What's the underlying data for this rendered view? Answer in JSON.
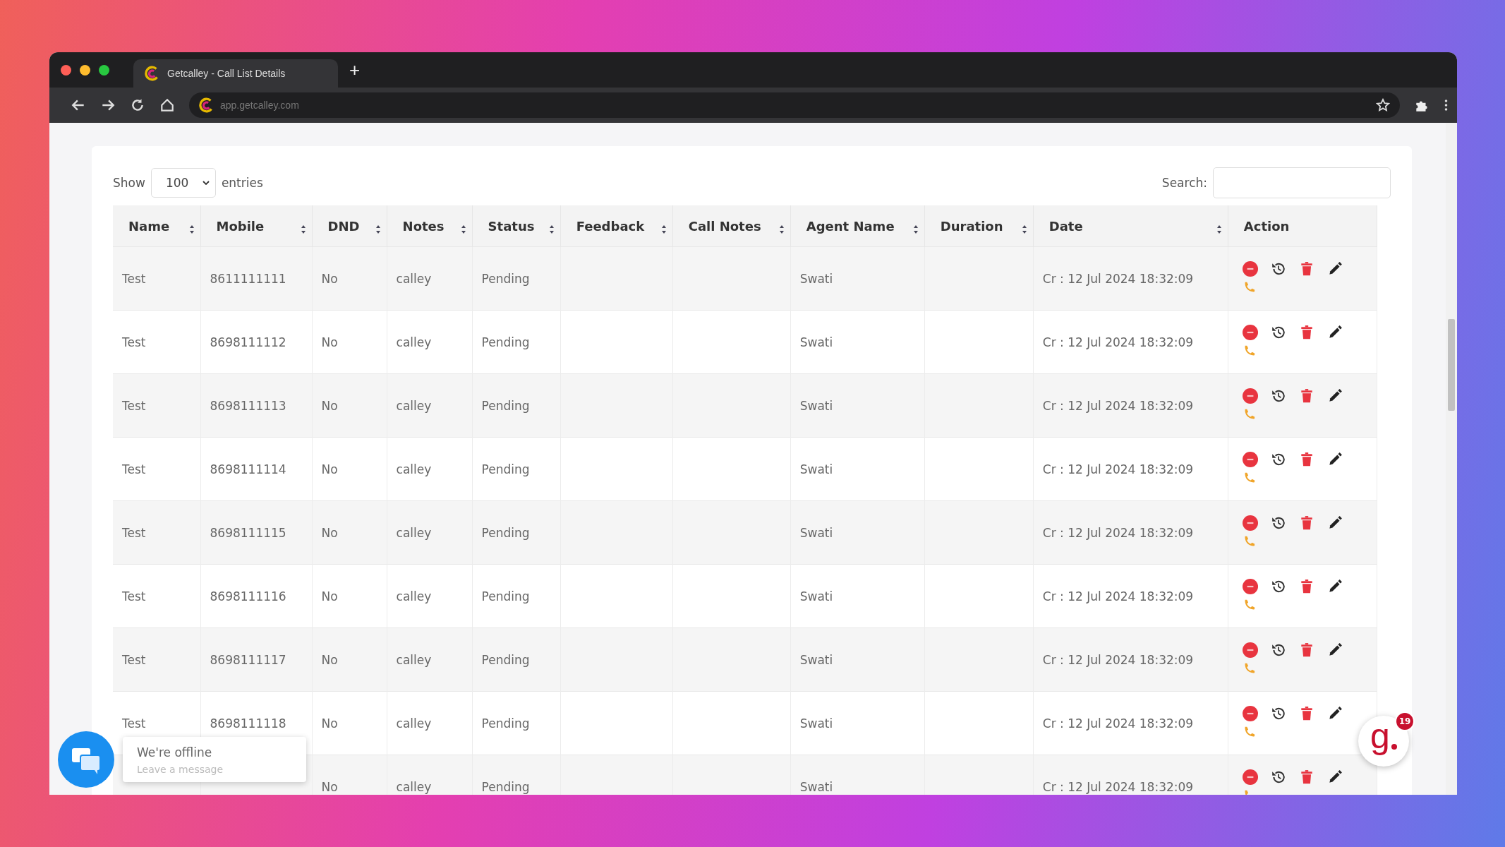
{
  "browser": {
    "tab_title": "Getcalley - Call List Details",
    "new_tab": "+",
    "url": "app.getcalley.com"
  },
  "controls": {
    "show_label": "Show",
    "page_length": "100",
    "entries_label": "entries",
    "search_label": "Search:"
  },
  "table": {
    "columns": [
      {
        "label": "Name",
        "sortable": true
      },
      {
        "label": "Mobile",
        "sortable": true
      },
      {
        "label": "DND",
        "sortable": true
      },
      {
        "label": "Notes",
        "sortable": true
      },
      {
        "label": "Status",
        "sortable": true
      },
      {
        "label": "Feedback",
        "sortable": true
      },
      {
        "label": "Call Notes",
        "sortable": true
      },
      {
        "label": "Agent Name",
        "sortable": true
      },
      {
        "label": "Duration",
        "sortable": true
      },
      {
        "label": "Date",
        "sortable": true
      },
      {
        "label": "Action",
        "sortable": false
      }
    ],
    "rows": [
      {
        "name": "Test",
        "mobile": "8611111111",
        "dnd": "No",
        "notes": "calley",
        "status": "Pending",
        "agent_name": "Swati",
        "date": "Cr : 12 Jul 2024 18:32:09"
      },
      {
        "name": "Test",
        "mobile": "8698111112",
        "dnd": "No",
        "notes": "calley",
        "status": "Pending",
        "agent_name": "Swati",
        "date": "Cr : 12 Jul 2024 18:32:09"
      },
      {
        "name": "Test",
        "mobile": "8698111113",
        "dnd": "No",
        "notes": "calley",
        "status": "Pending",
        "agent_name": "Swati",
        "date": "Cr : 12 Jul 2024 18:32:09"
      },
      {
        "name": "Test",
        "mobile": "8698111114",
        "dnd": "No",
        "notes": "calley",
        "status": "Pending",
        "agent_name": "Swati",
        "date": "Cr : 12 Jul 2024 18:32:09"
      },
      {
        "name": "Test",
        "mobile": "8698111115",
        "dnd": "No",
        "notes": "calley",
        "status": "Pending",
        "agent_name": "Swati",
        "date": "Cr : 12 Jul 2024 18:32:09"
      },
      {
        "name": "Test",
        "mobile": "8698111116",
        "dnd": "No",
        "notes": "calley",
        "status": "Pending",
        "agent_name": "Swati",
        "date": "Cr : 12 Jul 2024 18:32:09"
      },
      {
        "name": "Test",
        "mobile": "8698111117",
        "dnd": "No",
        "notes": "calley",
        "status": "Pending",
        "agent_name": "Swati",
        "date": "Cr : 12 Jul 2024 18:32:09"
      },
      {
        "name": "Test",
        "mobile": "8698111118",
        "dnd": "No",
        "notes": "calley",
        "status": "Pending",
        "agent_name": "Swati",
        "date": "Cr : 12 Jul 2024 18:32:09"
      },
      {
        "dnd": "No",
        "notes": "calley",
        "status": "Pending",
        "agent_name": "Swati",
        "date": "Cr : 12 Jul 2024 18:32:09"
      }
    ]
  },
  "chat": {
    "title": "We're offline",
    "subtitle": "Leave a message"
  },
  "brand_widget": {
    "letter": "g",
    "badge": "19"
  }
}
